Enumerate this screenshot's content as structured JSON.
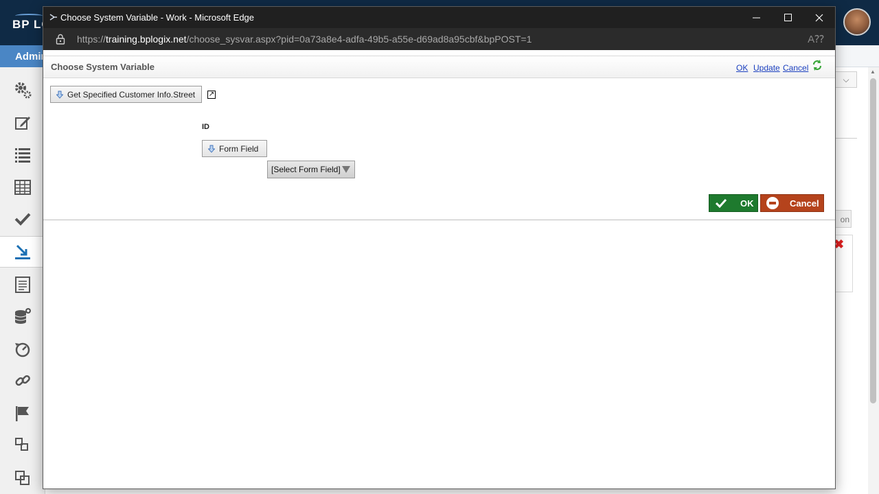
{
  "background_app": {
    "logo_text": "BP LO",
    "admin_tab": "Admir",
    "right_button_fragment": "on"
  },
  "window": {
    "title": "Choose System Variable - Work - Microsoft Edge",
    "url_prefix": "https://",
    "url_host": "training.bplogix.net",
    "url_path": "/choose_sysvar.aspx?pid=0a73a8e4-adfa-49b5-a55e-d69ad8a95cbf&bpPOST=1"
  },
  "dialog": {
    "title": "Choose System Variable",
    "header_links": {
      "ok": "OK",
      "update": "Update",
      "cancel": "Cancel"
    },
    "variable_token": "Get Specified Customer Info.Street",
    "param_label": "ID",
    "param_type_token": "Form Field",
    "select_placeholder": "[Select Form Field]",
    "ok_button": "OK",
    "cancel_button": "Cancel"
  },
  "colors": {
    "ok_green": "#1e7a2e",
    "cancel_red": "#b5431c",
    "link_blue": "#1a3fbf",
    "app_header": "#0f2a45"
  }
}
